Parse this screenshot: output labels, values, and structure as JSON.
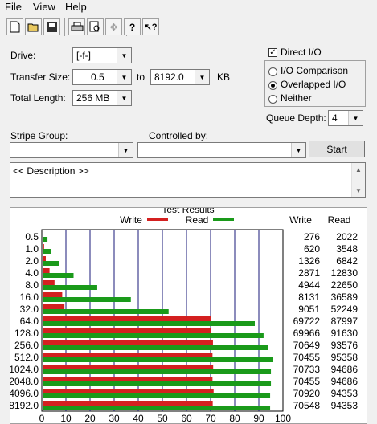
{
  "menu": [
    "File",
    "View",
    "Help"
  ],
  "toolbar_icons": [
    "new-icon",
    "open-icon",
    "save-icon",
    "print-icon",
    "print-preview-icon",
    "move-icon",
    "help-icon",
    "context-help-icon"
  ],
  "drive": {
    "label": "Drive:",
    "value": "[-f-]"
  },
  "transfer_size": {
    "label": "Transfer Size:",
    "from": "0.5",
    "to_label": "to",
    "to": "8192.0",
    "unit": "KB"
  },
  "total_length": {
    "label": "Total Length:",
    "value": "256 MB"
  },
  "direct_io": {
    "label": "Direct I/O",
    "checked": true
  },
  "mode": {
    "io_comparison": "I/O Comparison",
    "overlapped_io": "Overlapped I/O",
    "neither": "Neither",
    "selected": "overlapped_io"
  },
  "queue_depth": {
    "label": "Queue Depth:",
    "value": "4"
  },
  "stripe_group": {
    "label": "Stripe Group:",
    "value": ""
  },
  "controlled_by": {
    "label": "Controlled by:",
    "value": ""
  },
  "start_button": "Start",
  "description": "<< Description >>",
  "results": {
    "title": "Test Results",
    "write_legend": "Write",
    "read_legend": "Read",
    "write_col": "Write",
    "read_col": "Read"
  },
  "colors": {
    "write": "#d42020",
    "read": "#1a9a1a",
    "grid": "#1a1a7a"
  },
  "chart_data": {
    "type": "bar",
    "orientation": "horizontal",
    "title": "Test Results",
    "categories": [
      "0.5",
      "1.0",
      "2.0",
      "4.0",
      "8.0",
      "16.0",
      "32.0",
      "64.0",
      "128.0",
      "256.0",
      "512.0",
      "1024.0",
      "2048.0",
      "4096.0",
      "8192.0"
    ],
    "series": [
      {
        "name": "Write",
        "values": [
          276,
          620,
          1326,
          2871,
          4944,
          8131,
          9051,
          69722,
          69966,
          70649,
          70455,
          70733,
          70455,
          70920,
          70548
        ]
      },
      {
        "name": "Read",
        "values": [
          2022,
          3548,
          6842,
          12830,
          22650,
          36589,
          52249,
          87997,
          91630,
          93576,
          95358,
          94686,
          94686,
          94353,
          94353
        ]
      }
    ],
    "xticks": [
      "0",
      "10",
      "20",
      "30",
      "40",
      "50",
      "60",
      "70",
      "80",
      "90",
      "100"
    ],
    "xlim": [
      0,
      100
    ],
    "grid": true
  }
}
